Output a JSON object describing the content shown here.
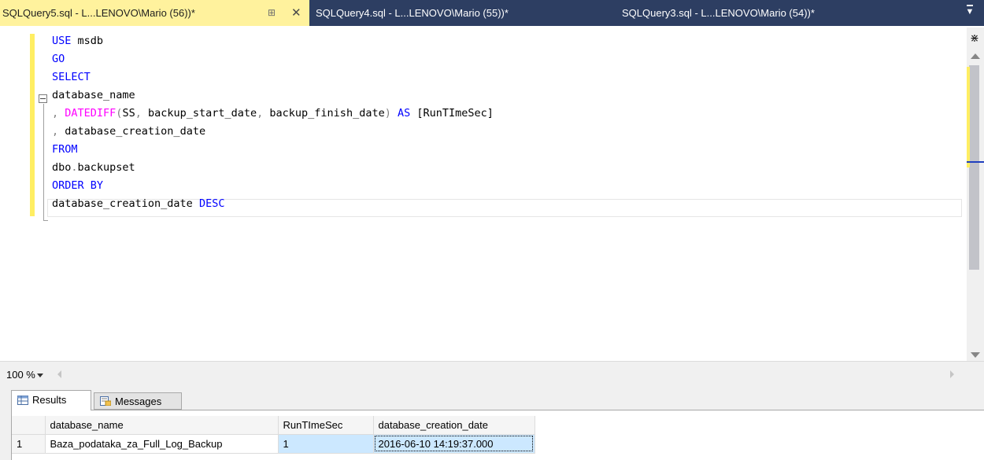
{
  "tabs": [
    {
      "title": "SQLQuery5.sql - L...LENOVO\\Mario (56))*",
      "active": true
    },
    {
      "title": "SQLQuery4.sql - L...LENOVO\\Mario (55))*",
      "active": false
    },
    {
      "title": "SQLQuery3.sql - L...LENOVO\\Mario (54))*",
      "active": false
    }
  ],
  "tab_icons": {
    "pin": "pin-icon",
    "close": "close-icon",
    "overflow": "tab-overflow-icon"
  },
  "editor": {
    "lines": [
      {
        "parts": [
          {
            "t": "USE",
            "c": "kw"
          },
          {
            "t": " msdb",
            "c": ""
          }
        ]
      },
      {
        "parts": [
          {
            "t": "GO",
            "c": "kw"
          }
        ]
      },
      {
        "parts": [
          {
            "t": "SELECT",
            "c": "kw"
          }
        ]
      },
      {
        "parts": [
          {
            "t": "database_name",
            "c": ""
          }
        ]
      },
      {
        "parts": [
          {
            "t": ", ",
            "c": "gr"
          },
          {
            "t": "DATEDIFF",
            "c": "fn"
          },
          {
            "t": "(",
            "c": "gr"
          },
          {
            "t": "SS",
            "c": ""
          },
          {
            "t": ", ",
            "c": "gr"
          },
          {
            "t": "backup_start_date",
            "c": ""
          },
          {
            "t": ", ",
            "c": "gr"
          },
          {
            "t": "backup_finish_date",
            "c": ""
          },
          {
            "t": ") ",
            "c": "gr"
          },
          {
            "t": "AS",
            "c": "kw"
          },
          {
            "t": " [RunTImeSec]",
            "c": ""
          }
        ]
      },
      {
        "parts": [
          {
            "t": ", ",
            "c": "gr"
          },
          {
            "t": "database_creation_date",
            "c": ""
          }
        ]
      },
      {
        "parts": [
          {
            "t": "FROM",
            "c": "kw"
          }
        ]
      },
      {
        "parts": [
          {
            "t": "dbo",
            "c": ""
          },
          {
            "t": ".",
            "c": "gr"
          },
          {
            "t": "backupset",
            "c": ""
          }
        ]
      },
      {
        "parts": [
          {
            "t": "ORDER BY",
            "c": "kw"
          }
        ]
      },
      {
        "parts": [
          {
            "t": "database_creation_date ",
            "c": ""
          },
          {
            "t": "DESC",
            "c": "kw"
          }
        ]
      }
    ]
  },
  "zoom": {
    "value": "100 %"
  },
  "results": {
    "tabs": [
      {
        "label": "Results",
        "icon": "grid-icon"
      },
      {
        "label": "Messages",
        "icon": "messages-icon"
      }
    ],
    "columns": [
      "",
      "database_name",
      "RunTImeSec",
      "database_creation_date"
    ],
    "rows": [
      [
        "1",
        "Baza_podataka_za_Full_Log_Backup",
        "1",
        "2016-06-10 14:19:37.000"
      ]
    ]
  },
  "colors": {
    "tab_bar": "#2d3e62",
    "active_tab": "#fff29d",
    "keyword": "#0000ff",
    "function": "#ff00ff",
    "operator": "#808080",
    "selection": "#cce8ff"
  }
}
